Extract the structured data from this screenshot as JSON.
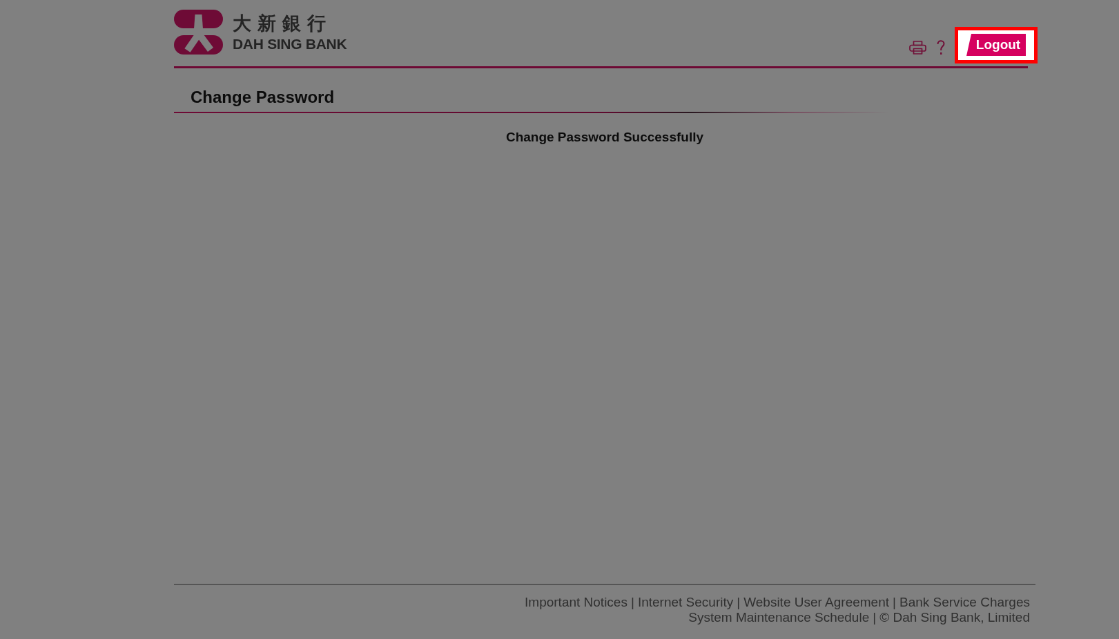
{
  "header": {
    "logo": {
      "chinese_name": "大新銀行",
      "english_name": "DAH SING BANK"
    },
    "logout_button": {
      "label": "Logout",
      "highlighted": true
    }
  },
  "page_title": "Change Password",
  "message": "Change Password Successfully",
  "footer": {
    "separator": "|",
    "link_lines": [
      [
        "Important Notices",
        "Internet Security",
        "Website User Agreement",
        "Bank Service Charges"
      ],
      [
        "System Maintenance Schedule"
      ]
    ],
    "copyright": "© Dah Sing Bank, Limited"
  }
}
